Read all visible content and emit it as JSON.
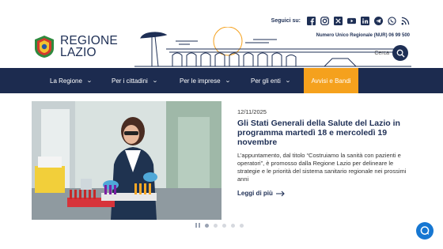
{
  "brand": {
    "line1": "REGIONE",
    "line2": "LAZIO"
  },
  "social": {
    "label": "Seguici su:",
    "icons": [
      "facebook-icon",
      "instagram-icon",
      "x-icon",
      "youtube-icon",
      "linkedin-icon",
      "telegram-icon",
      "whatsapp-icon",
      "rss-icon"
    ]
  },
  "nur": "Numero Unico Regionale (NUR) 06 99 500",
  "search": {
    "label": "Cerca"
  },
  "nav": {
    "items": [
      {
        "label": "La Regione"
      },
      {
        "label": "Per i cittadini"
      },
      {
        "label": "Per le imprese"
      },
      {
        "label": "Per gli enti"
      },
      {
        "label": "Avvisi e Bandi"
      }
    ]
  },
  "article": {
    "date": "12/11/2025",
    "title": "Gli Stati Generali della Salute del Lazio in programma martedì 18 e mercoledì 19 novembre",
    "summary": "L’appuntamento, dal titolo “Costruiamo la sanità con pazienti e operatori”, è promosso dalla Regione Lazio per delineare le strategie e le priorità del sistema sanitario regionale nei prossimi anni",
    "more": "Leggi di più"
  },
  "colors": {
    "navy": "#1c2b4f",
    "accent": "#f5a11d",
    "chat": "#1677d2"
  }
}
